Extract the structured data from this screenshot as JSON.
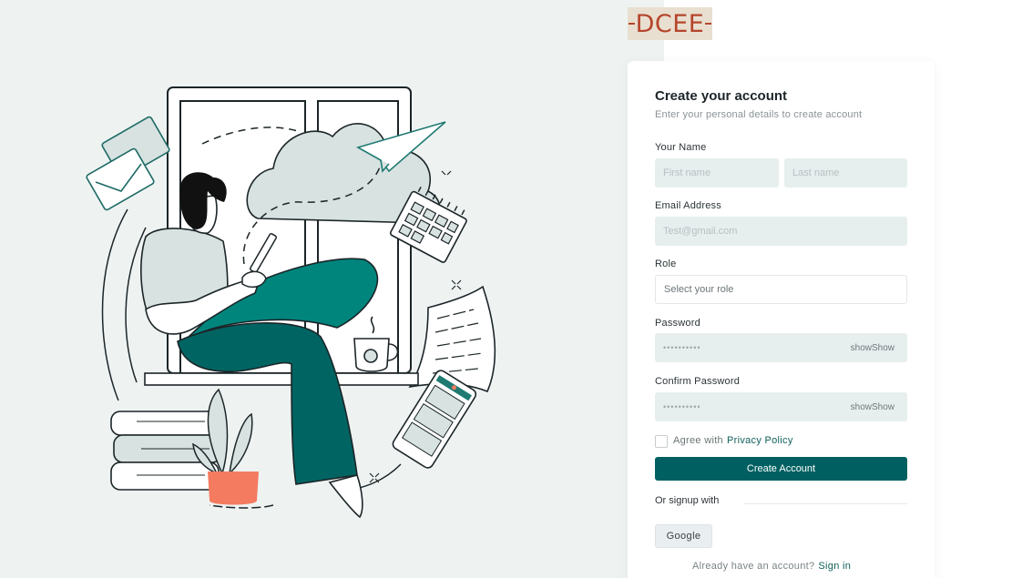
{
  "brand": {
    "logo_text": "DCEE"
  },
  "form": {
    "title": "Create your account",
    "subtitle": "Enter your personal details to create account",
    "name_label": "Your Name",
    "first_name_placeholder": "First name",
    "last_name_placeholder": "Last name",
    "email_label": "Email Address",
    "email_placeholder": "Test@gmail.com",
    "role_label": "Role",
    "role_placeholder": "Select your role",
    "password_label": "Password",
    "password_value": "••••••••••",
    "password_show": "showShow",
    "confirm_label": "Confirm Password",
    "confirm_value": "••••••••••",
    "confirm_show": "showShow",
    "agree_text": "Agree with",
    "privacy_link": "Privacy Policy",
    "submit_label": "Create Account",
    "or_signup": "Or signup with",
    "google_label": "Google",
    "already_text": "Already have an account?",
    "signin_link": "Sign in"
  },
  "colors": {
    "primary": "#006061",
    "left_bg": "#eef3f2",
    "illustration_teal": "#00857d",
    "illustration_dark_teal": "#006462",
    "pot": "#f47b5f",
    "logo": "#b5452c"
  },
  "icons": [
    "envelope-icon",
    "paper-plane-icon",
    "calendar-icon",
    "cloud-icon",
    "coffee-cup-icon",
    "phone-icon",
    "document-icon",
    "plant-icon",
    "books-icon"
  ]
}
